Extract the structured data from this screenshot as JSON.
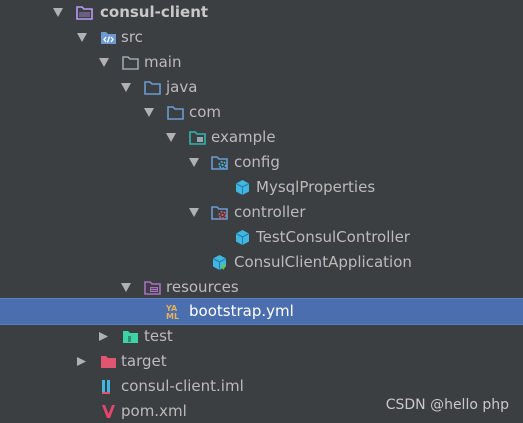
{
  "colors": {
    "background": "#3c3f41",
    "text": "#bbbbbb",
    "selection": "#4b6eaf",
    "folder": "#9aa7b0",
    "source_folder": "#6b9bd1",
    "package_folder": "#2fb6b0",
    "resources_folder": "#a771bf",
    "test_folder": "#3ed3a5",
    "excluded_folder": "#e05670",
    "class_icon": "#40b6e0",
    "maven": "#e8456c"
  },
  "tree": {
    "module": {
      "label": "consul-client",
      "icon": "folder-module-icon"
    },
    "src": {
      "label": "src",
      "icon": "source-root-icon"
    },
    "main": {
      "label": "main",
      "icon": "folder-icon"
    },
    "java": {
      "label": "java",
      "icon": "source-folder-icon"
    },
    "com": {
      "label": "com",
      "icon": "package-icon"
    },
    "example": {
      "label": "example",
      "icon": "package-icon"
    },
    "config": {
      "label": "config",
      "icon": "spring-config-package-icon"
    },
    "mysql_properties": {
      "label": "MysqlProperties",
      "icon": "class-icon"
    },
    "controller": {
      "label": "controller",
      "icon": "spring-controller-package-icon"
    },
    "test_consul_controller": {
      "label": "TestConsulController",
      "icon": "class-icon"
    },
    "consul_client_application": {
      "label": "ConsulClientApplication",
      "icon": "spring-boot-class-icon"
    },
    "resources": {
      "label": "resources",
      "icon": "resources-folder-icon"
    },
    "bootstrap": {
      "label": "bootstrap.yml",
      "icon": "yaml-file-icon",
      "selected": true
    },
    "test": {
      "label": "test",
      "icon": "test-folder-icon"
    },
    "target": {
      "label": "target",
      "icon": "excluded-folder-icon"
    },
    "iml": {
      "label": "consul-client.iml",
      "icon": "iml-file-icon"
    },
    "pom": {
      "label": "pom.xml",
      "icon": "maven-icon"
    }
  },
  "watermark": "CSDN @hello php"
}
